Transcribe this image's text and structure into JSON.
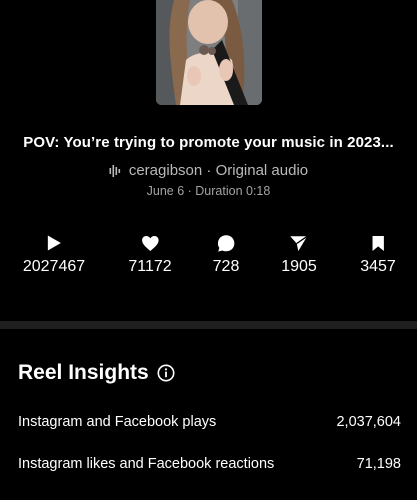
{
  "reel": {
    "caption": "POV: You’re trying to promote your music in 2023...",
    "username": "ceragibson",
    "audio_separator": " · ",
    "audio_label": "Original audio",
    "date_label": "June 6 · Duration 0:18"
  },
  "stats": [
    {
      "icon": "play-icon",
      "value": "2027467"
    },
    {
      "icon": "heart-icon",
      "value": "71172"
    },
    {
      "icon": "comment-icon",
      "value": "728"
    },
    {
      "icon": "share-icon",
      "value": "1905"
    },
    {
      "icon": "bookmark-icon",
      "value": "3457"
    }
  ],
  "insights": {
    "title": "Reel Insights",
    "rows": [
      {
        "label": "Instagram and Facebook plays",
        "value": "2,037,604"
      },
      {
        "label": "Instagram likes and Facebook reactions",
        "value": "71,198"
      }
    ]
  },
  "colors": {
    "background": "#000000",
    "text_primary": "#ffffff",
    "text_secondary": "#b9b9b9",
    "divider": "#1f1f1f"
  }
}
